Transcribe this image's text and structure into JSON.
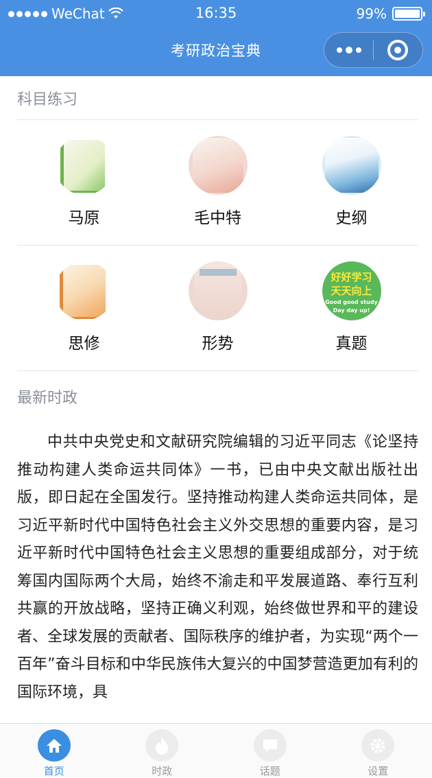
{
  "status_bar": {
    "carrier": "WeChat",
    "time": "16:35",
    "battery_text": "99%",
    "battery_level": 0.99
  },
  "nav": {
    "title": "考研政治宝典"
  },
  "subjects_section": {
    "title": "科目练习",
    "items": [
      {
        "label": "马原",
        "icon": "book-cover-marxism"
      },
      {
        "label": "毛中特",
        "icon": "book-cover-mao"
      },
      {
        "label": "史纲",
        "icon": "book-cover-history"
      },
      {
        "label": "思修",
        "icon": "book-cover-morality"
      },
      {
        "label": "形势",
        "icon": "book-cover-situation"
      },
      {
        "label": "真题",
        "icon": "book-cover-exam"
      }
    ],
    "zhenti_cover": {
      "line1": "好好学习",
      "line2": "天天向上",
      "line3": "Good good study",
      "line4": "Day day up!"
    }
  },
  "news_section": {
    "title": "最新时政",
    "body": "中共中央党史和文献研究院编辑的习近平同志《论坚持推动构建人类命运共同体》一书，已由中央文献出版社出版，即日起在全国发行。坚持推动构建人类命运共同体，是习近平新时代中国特色社会主义外交思想的重要内容，是习近平新时代中国特色社会主义思想的重要组成部分，对于统筹国内国际两个大局，始终不渝走和平发展道路、奉行互利共赢的开放战略，坚持正确义利观，始终做世界和平的建设者、全球发展的贡献者、国际秩序的维护者，为实现“两个一百年”奋斗目标和中华民族伟大复兴的中国梦营造更加有利的国际环境，具"
  },
  "tabbar": {
    "tabs": [
      {
        "label": "首页",
        "icon": "home-icon",
        "active": true
      },
      {
        "label": "时政",
        "icon": "hot-icon",
        "active": false
      },
      {
        "label": "话题",
        "icon": "chat-icon",
        "active": false
      },
      {
        "label": "设置",
        "icon": "gear-icon",
        "active": false
      }
    ]
  },
  "colors": {
    "header": "#4a90e2",
    "accent": "#3a8fe0",
    "section_title": "#8a8f99"
  }
}
